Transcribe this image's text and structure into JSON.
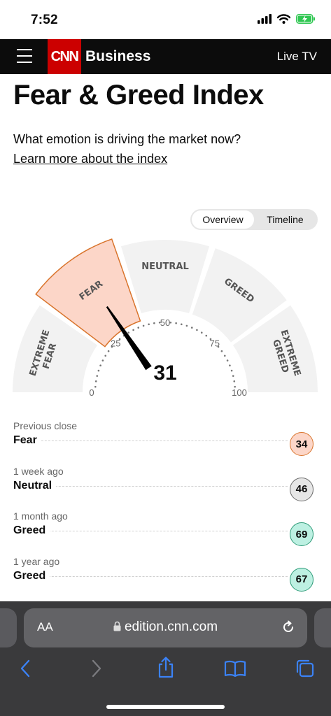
{
  "status": {
    "time": "7:52"
  },
  "header": {
    "brand": "CNN",
    "section": "Business",
    "live": "Live TV"
  },
  "page": {
    "title": "Fear & Greed Index",
    "subtitle": "What emotion is driving the market now?",
    "learn_link": "Learn more about the index"
  },
  "toggle": {
    "overview": "Overview",
    "timeline": "Timeline",
    "active": "Overview"
  },
  "gauge": {
    "value": 31,
    "current_zone": "FEAR",
    "zones": [
      "EXTREME FEAR",
      "FEAR",
      "NEUTRAL",
      "GREED",
      "EXTREME GREED"
    ],
    "ticks": [
      "0",
      "25",
      "50",
      "75",
      "100"
    ],
    "highlight_color": "#fcd6c8",
    "highlight_border": "#d9742c"
  },
  "history": [
    {
      "when": "Previous close",
      "label": "Fear",
      "value": "34",
      "color": "#fcd6c8",
      "border": "#d9742c"
    },
    {
      "when": "1 week ago",
      "label": "Neutral",
      "value": "46",
      "color": "#e6e6e6",
      "border": "#6b6b6b"
    },
    {
      "when": "1 month ago",
      "label": "Greed",
      "value": "69",
      "color": "#bdf0e2",
      "border": "#2e9b78"
    },
    {
      "when": "1 year ago",
      "label": "Greed",
      "value": "67",
      "color": "#bdf0e2",
      "border": "#2e9b78"
    }
  ],
  "safari": {
    "aa": "AA",
    "url": "edition.cnn.com"
  }
}
